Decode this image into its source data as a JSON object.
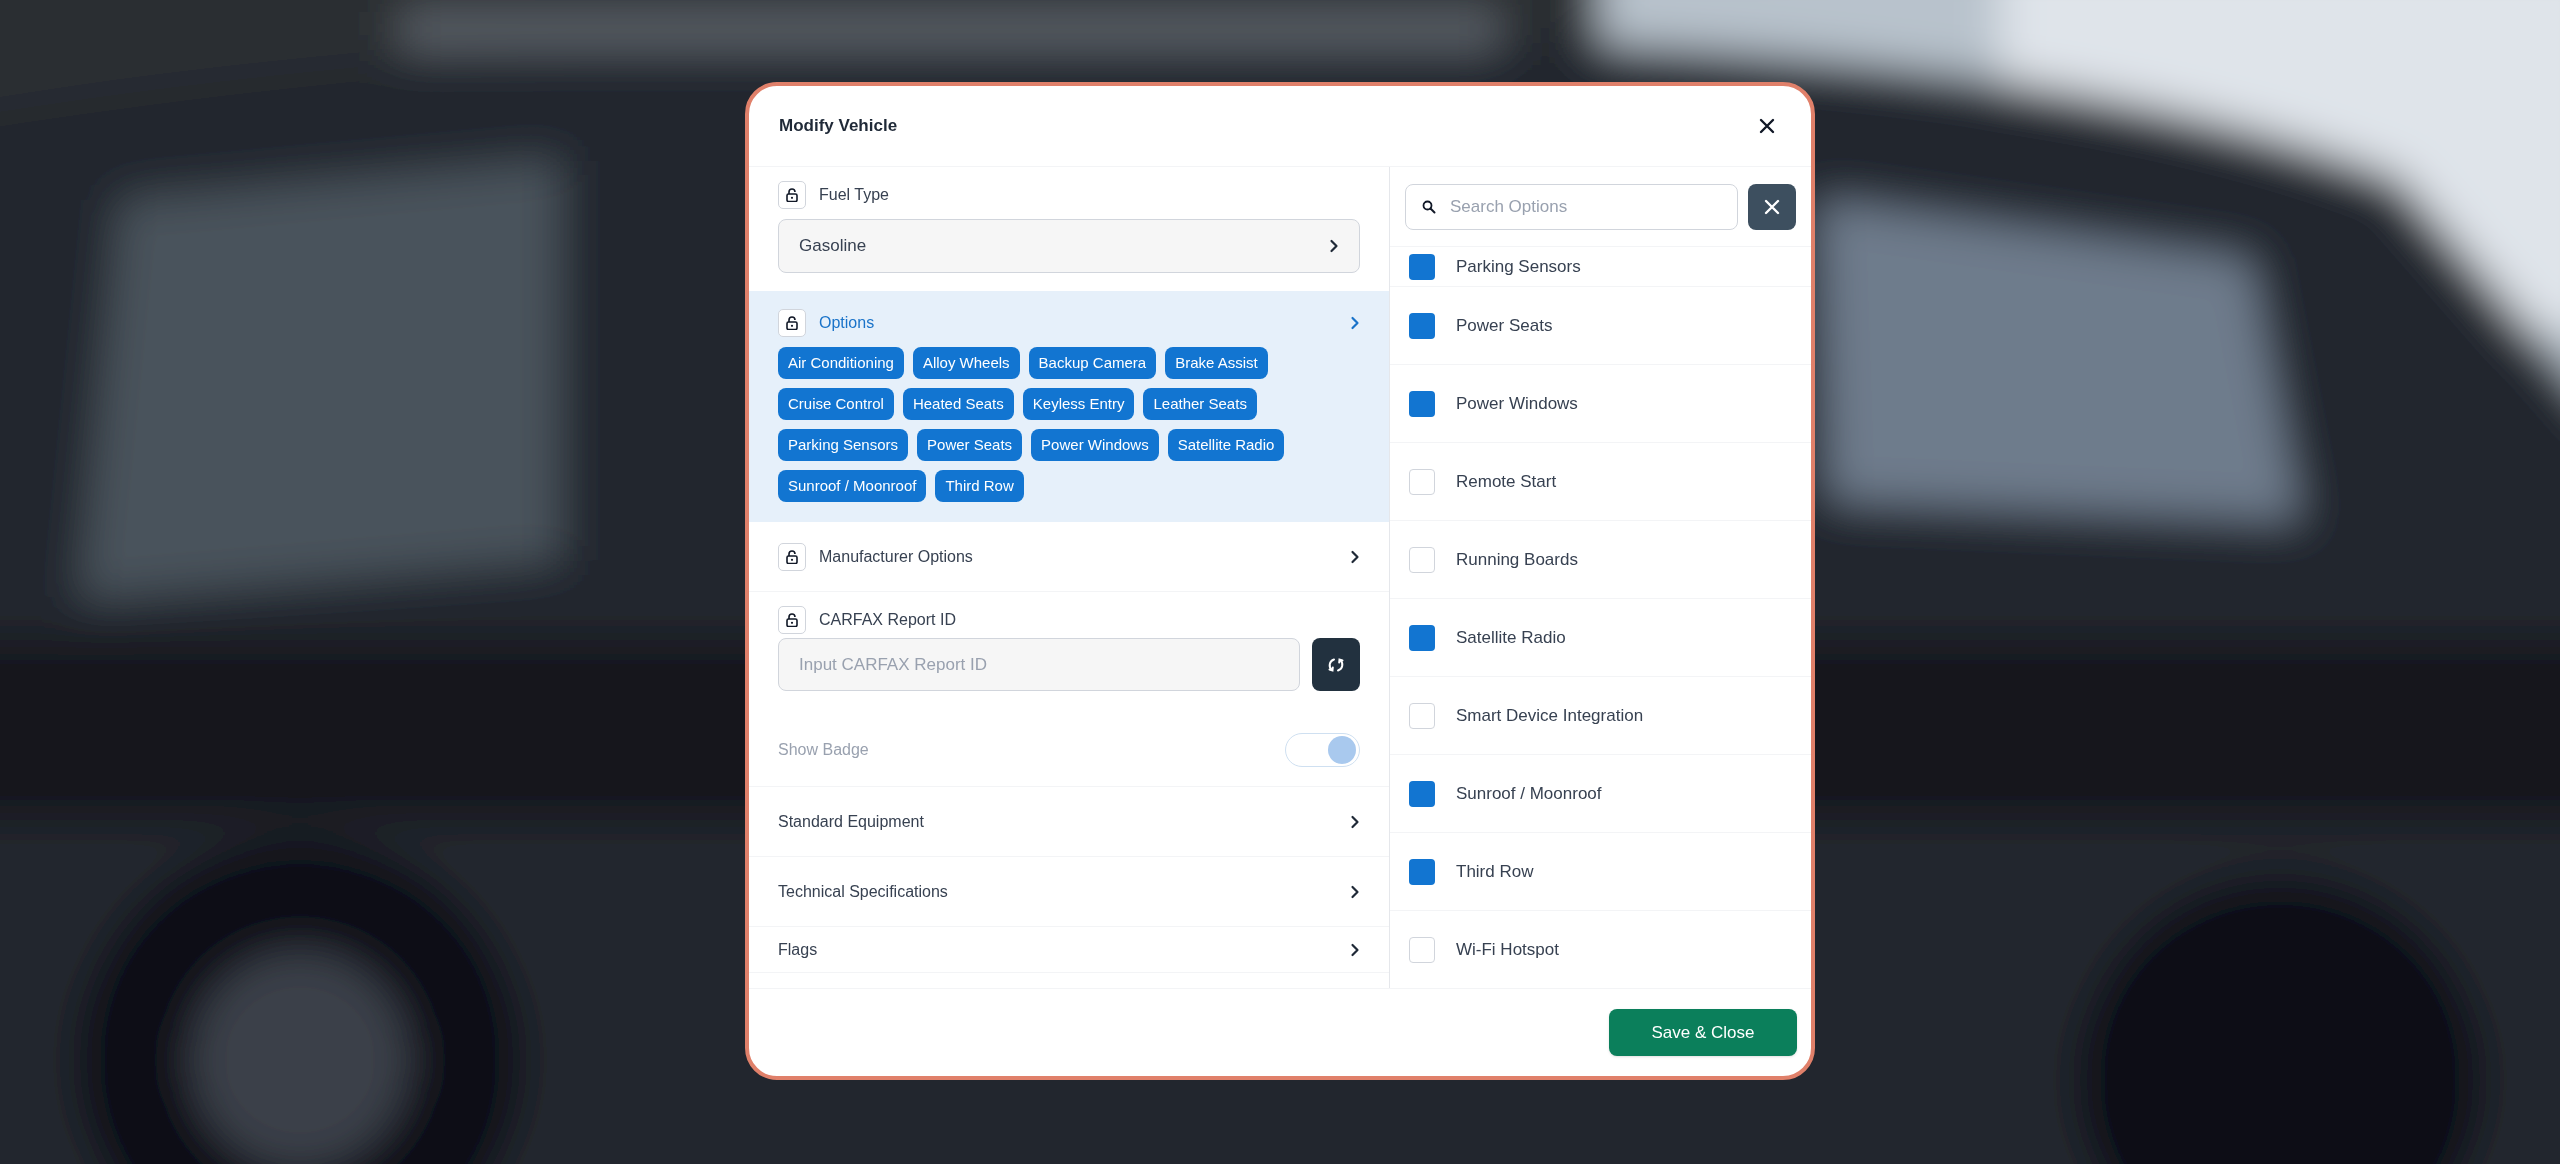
{
  "dialog": {
    "title": "Modify Vehicle"
  },
  "left_panel": {
    "sections": [
      {
        "kind": "select",
        "label": "Fuel Type",
        "lockable": true,
        "value": "Gasoline"
      },
      {
        "kind": "chips",
        "label": "Options",
        "lockable": true,
        "selected": true,
        "chips": [
          "Air Conditioning",
          "Alloy Wheels",
          "Backup Camera",
          "Brake Assist",
          "Cruise Control",
          "Heated Seats",
          "Keyless Entry",
          "Leather Seats",
          "Parking Sensors",
          "Power Seats",
          "Power Windows",
          "Satellite Radio",
          "Sunroof / Moonroof",
          "Third Row"
        ]
      },
      {
        "kind": "link",
        "label": "Manufacturer Options",
        "lockable": true,
        "selected": false
      },
      {
        "kind": "input",
        "label": "CARFAX Report ID",
        "lockable": true,
        "placeholder": "Input CARFAX Report ID"
      },
      {
        "kind": "toggle",
        "label": "Show Badge",
        "on": true,
        "disabled": true
      },
      {
        "kind": "link",
        "label": "Standard Equipment",
        "lockable": false,
        "selected": false
      },
      {
        "kind": "link",
        "label": "Technical Specifications",
        "lockable": false,
        "selected": false
      },
      {
        "kind": "link",
        "label": "Flags",
        "lockable": false,
        "selected": false
      }
    ]
  },
  "right_panel": {
    "search": {
      "placeholder": "Search Options"
    },
    "options": [
      {
        "label": "Parking Sensors",
        "checked": true
      },
      {
        "label": "Power Seats",
        "checked": true
      },
      {
        "label": "Power Windows",
        "checked": true
      },
      {
        "label": "Remote Start",
        "checked": false
      },
      {
        "label": "Running Boards",
        "checked": false
      },
      {
        "label": "Satellite Radio",
        "checked": true
      },
      {
        "label": "Smart Device Integration",
        "checked": false
      },
      {
        "label": "Sunroof / Moonroof",
        "checked": true
      },
      {
        "label": "Third Row",
        "checked": true
      },
      {
        "label": "Wi-Fi Hotspot",
        "checked": false
      }
    ]
  },
  "footer": {
    "primary_button": "Save & Close"
  }
}
